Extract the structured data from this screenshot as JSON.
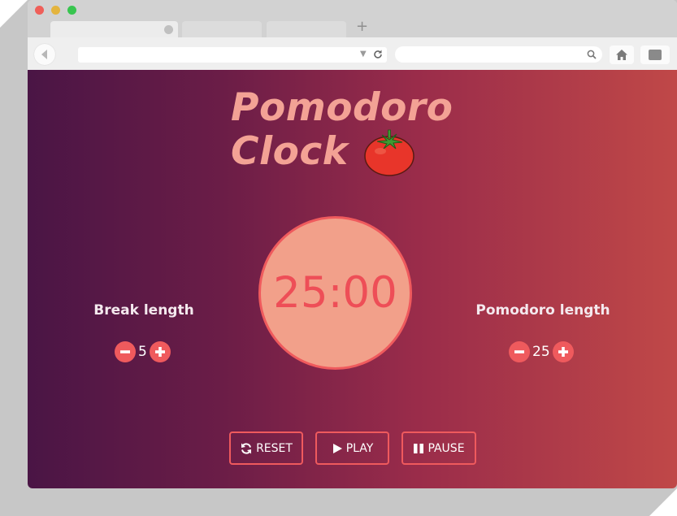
{
  "app": {
    "title_line1": "Pomodoro",
    "title_line2": "Clock"
  },
  "timer": {
    "display": "25:00"
  },
  "break": {
    "label": "Break length",
    "value": "5"
  },
  "pomodoro": {
    "label": "Pomodoro length",
    "value": "25"
  },
  "controls": {
    "reset_label": "RESET",
    "play_label": "PLAY",
    "pause_label": "PAUSE"
  },
  "browser": {
    "new_tab": "+"
  },
  "colors": {
    "accent": "#ef5a5d",
    "title": "#f3a295",
    "clock_face": "#f2a08a",
    "gradient_start": "#4a1545",
    "gradient_end": "#c04848"
  },
  "icons": {
    "decrement": "minus-icon",
    "increment": "plus-icon",
    "reset": "refresh-icon",
    "play": "play-icon",
    "pause": "pause-icon",
    "tomato": "tomato-icon"
  }
}
